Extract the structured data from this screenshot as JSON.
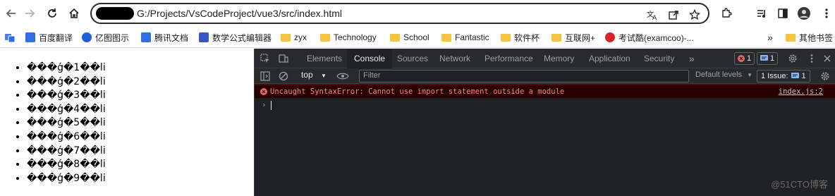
{
  "browser": {
    "url": "G:/Projects/VsCodeProject/vue3/src/index.html"
  },
  "bookmarks": [
    {
      "label": "百度翻译",
      "icon": "baidu-translate-icon",
      "color": "#2f6ee6"
    },
    {
      "label": "亿图图示",
      "icon": "edraw-icon",
      "color": "#1e5fd6"
    },
    {
      "label": "腾讯文档",
      "icon": "tencent-docs-icon",
      "color": "#2f6ee6"
    },
    {
      "label": "数学公式编辑器",
      "icon": "math-editor-icon",
      "color": "#3b55c9"
    },
    {
      "label": "zyx",
      "icon": "folder-icon",
      "color": "#f4c542"
    },
    {
      "label": "Technology",
      "icon": "folder-icon",
      "color": "#f4c542"
    },
    {
      "label": "School",
      "icon": "folder-icon",
      "color": "#f4c542"
    },
    {
      "label": "Fantastic",
      "icon": "folder-icon",
      "color": "#f4c542"
    },
    {
      "label": "软件杯",
      "icon": "folder-icon",
      "color": "#f4c542"
    },
    {
      "label": "互联网+",
      "icon": "folder-icon",
      "color": "#f4c542"
    },
    {
      "label": "考试酷(examcoo)-...",
      "icon": "examcoo-icon",
      "color": "#d6242a"
    }
  ],
  "bookmarks_overflow": "»",
  "other_bookmarks": "其他书签",
  "page": {
    "items": [
      "���ǵ�1��li",
      "���ǵ�2��li",
      "���ǵ�3��li",
      "���ǵ�4��li",
      "���ǵ�5��li",
      "���ǵ�6��li",
      "���ǵ�7��li",
      "���ǵ�8��li",
      "���ǵ�9��li"
    ]
  },
  "devtools": {
    "tabs": [
      "Elements",
      "Console",
      "Sources",
      "Network",
      "Performance",
      "Memory",
      "Application",
      "Security"
    ],
    "more_tabs": "»",
    "error_count": "1",
    "message_count": "1",
    "context": "top",
    "filter_placeholder": "Filter",
    "levels": "Default levels",
    "issues": "1 Issue:",
    "issues_count": "1",
    "error_message": "Uncaught SyntaxError: Cannot use import statement outside a module",
    "error_source": "index.js:2",
    "prompt": "›"
  },
  "watermark": "@51CTO博客",
  "colors": {
    "accent": "#8ab4f8",
    "error": "#ff8080"
  }
}
